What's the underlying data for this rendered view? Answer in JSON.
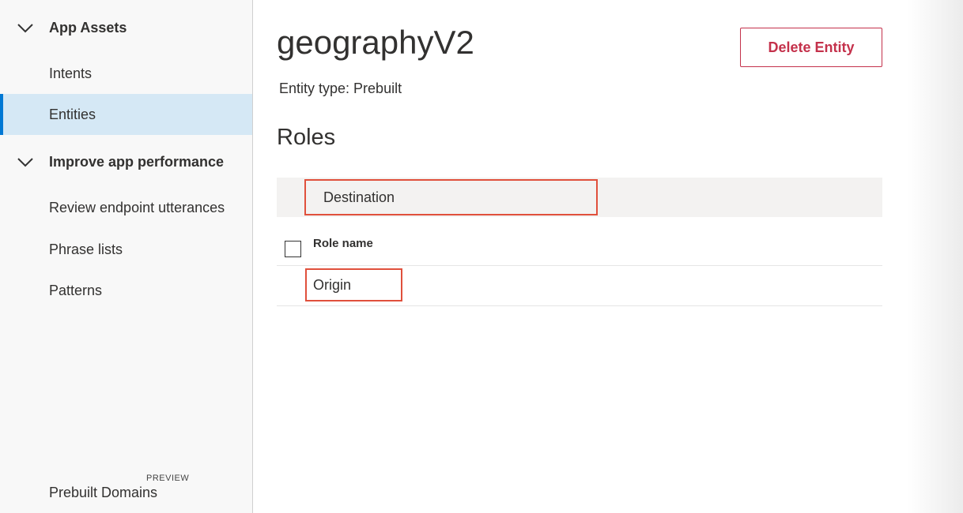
{
  "sidebar": {
    "sections": [
      {
        "label": "App Assets",
        "items": [
          {
            "label": "Intents"
          },
          {
            "label": "Entities"
          }
        ]
      },
      {
        "label": "Improve app performance",
        "items": [
          {
            "label": "Review endpoint utterances"
          },
          {
            "label": "Phrase lists"
          },
          {
            "label": "Patterns"
          }
        ]
      }
    ],
    "footer": {
      "label": "Prebuilt Domains",
      "badge": "PREVIEW"
    }
  },
  "entity": {
    "name": "geographyV2",
    "type_text": "Entity type: Prebuilt"
  },
  "actions": {
    "delete_label": "Delete Entity"
  },
  "roles": {
    "title": "Roles",
    "input_value": "Destination",
    "column_header": "Role name",
    "rows": [
      {
        "name": "Origin"
      }
    ]
  },
  "colors": {
    "accent": "#0078d4",
    "danger": "#c4314b",
    "highlight": "#e0503c",
    "selected_bg": "#d5e8f5"
  }
}
